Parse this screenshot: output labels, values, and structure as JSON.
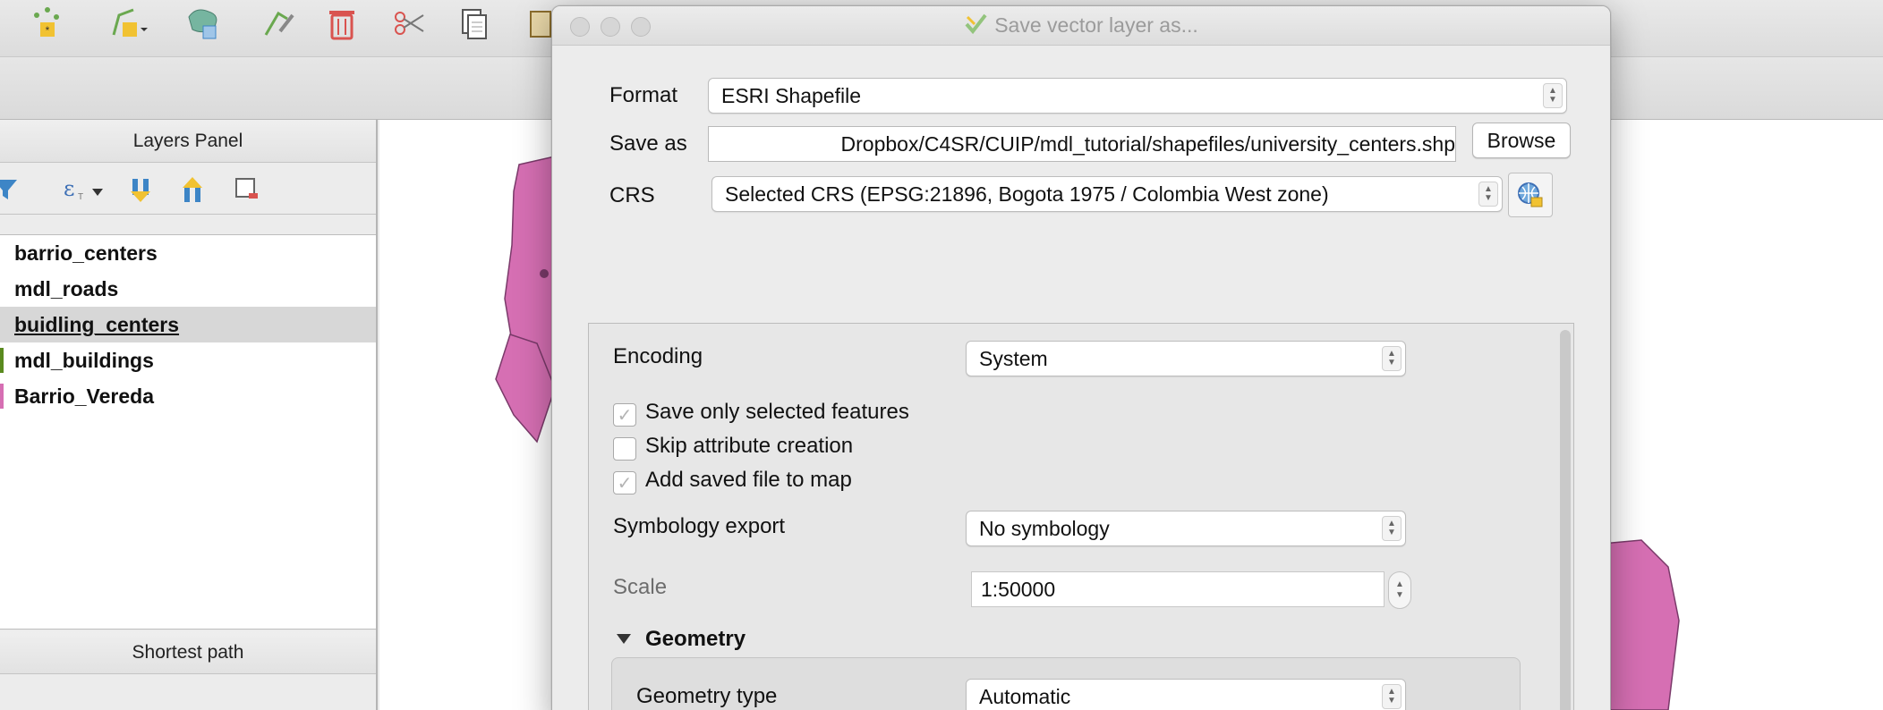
{
  "layers_panel": {
    "title": "Layers Panel",
    "layers": [
      {
        "name": "barrio_centers",
        "selected": false,
        "swatch": ""
      },
      {
        "name": "mdl_roads",
        "selected": false,
        "swatch": ""
      },
      {
        "name": "buidling_centers",
        "selected": true,
        "swatch": ""
      },
      {
        "name": "mdl_buildings",
        "selected": false,
        "swatch": "#5a8a1f"
      },
      {
        "name": "Barrio_Vereda",
        "selected": false,
        "swatch": "#d66fb3"
      }
    ],
    "bottom_panel_title": "Shortest path"
  },
  "map": {
    "polygon_fill": "#d66fb3",
    "polygon_stroke": "#7a3a6a"
  },
  "dialog": {
    "title": "Save vector layer as...",
    "format_label": "Format",
    "format_value": "ESRI Shapefile",
    "save_as_label": "Save as",
    "save_as_value": "Dropbox/C4SR/CUIP/mdl_tutorial/shapefiles/university_centers.shp",
    "browse_label": "Browse",
    "crs_label": "CRS",
    "crs_value": "Selected CRS (EPSG:21896, Bogota 1975 / Colombia West zone)",
    "encoding_label": "Encoding",
    "encoding_value": "System",
    "save_selected_label": "Save only selected features",
    "save_selected_checked": true,
    "skip_attr_label": "Skip attribute creation",
    "skip_attr_checked": false,
    "add_to_map_label": "Add saved file to map",
    "add_to_map_checked": true,
    "symbology_label": "Symbology export",
    "symbology_value": "No symbology",
    "scale_label": "Scale",
    "scale_value": "1:50000",
    "geometry_section_label": "Geometry",
    "geometry_type_label": "Geometry type",
    "geometry_type_value": "Automatic"
  }
}
